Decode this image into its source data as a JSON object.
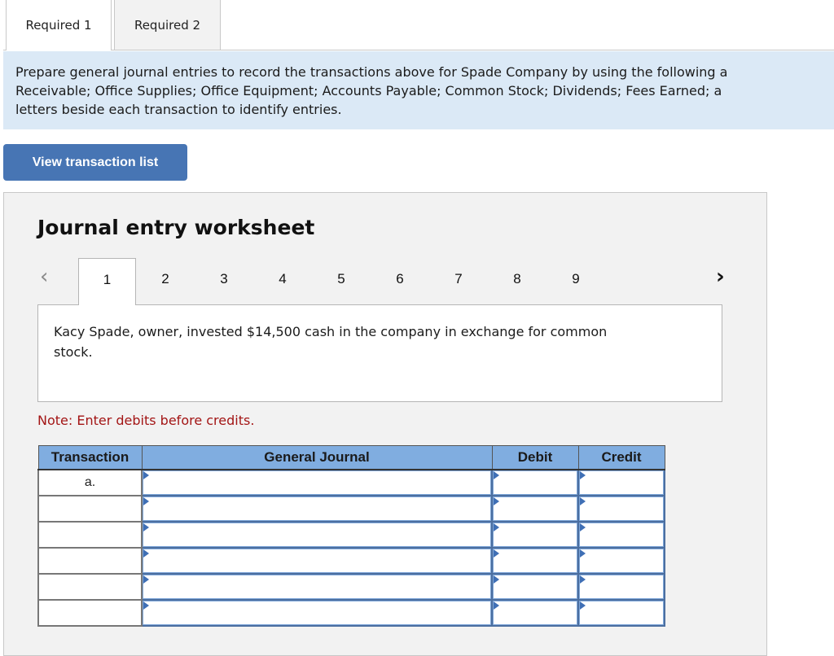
{
  "tabs": [
    {
      "label": "Required 1",
      "active": true
    },
    {
      "label": "Required 2",
      "active": false
    }
  ],
  "instructions": {
    "lines": [
      "Prepare general journal entries to record the transactions above for Spade Company by using the following a",
      "Receivable; Office Supplies; Office Equipment; Accounts Payable; Common Stock; Dividends; Fees Earned; a",
      "letters beside each transaction to identify entries."
    ]
  },
  "view_button": {
    "label": "View transaction list"
  },
  "worksheet": {
    "title": "Journal entry worksheet",
    "nav_prev_icon": "chevron-left",
    "nav_next_icon": "chevron-right",
    "steps": [
      "1",
      "2",
      "3",
      "4",
      "5",
      "6",
      "7",
      "8",
      "9"
    ],
    "active_step": "1",
    "description": "Kacy Spade, owner, invested $14,500 cash in the company in exchange for common stock.",
    "note": "Note: Enter debits before credits.",
    "table": {
      "headers": [
        "Transaction",
        "General Journal",
        "Debit",
        "Credit"
      ],
      "rows": [
        {
          "transaction": "a.",
          "account": "",
          "debit": "",
          "credit": ""
        },
        {
          "transaction": "",
          "account": "",
          "debit": "",
          "credit": ""
        },
        {
          "transaction": "",
          "account": "",
          "debit": "",
          "credit": ""
        },
        {
          "transaction": "",
          "account": "",
          "debit": "",
          "credit": ""
        },
        {
          "transaction": "",
          "account": "",
          "debit": "",
          "credit": ""
        },
        {
          "transaction": "",
          "account": "",
          "debit": "",
          "credit": ""
        }
      ]
    }
  },
  "colors": {
    "button_blue": "#4775b4",
    "header_blue": "#80ade0",
    "instruction_bg": "#dbe9f6",
    "note_red": "#a31515"
  }
}
